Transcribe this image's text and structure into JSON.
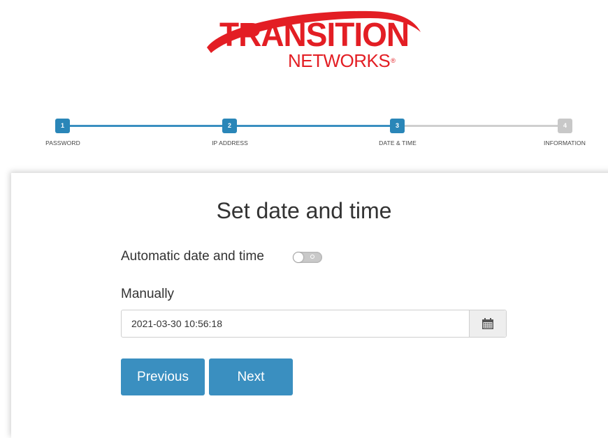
{
  "logo": {
    "line1": "TRANSITION",
    "line2": "NETWORKS",
    "reg": "®",
    "brand_color": "#e31e24"
  },
  "stepper": {
    "active_color": "#2a86b8",
    "inactive_color": "#c8c8c8",
    "current_step": 3,
    "steps": [
      {
        "number": "1",
        "label": "PASSWORD",
        "state": "done"
      },
      {
        "number": "2",
        "label": "IP ADDRESS",
        "state": "done"
      },
      {
        "number": "3",
        "label": "DATE & TIME",
        "state": "current"
      },
      {
        "number": "4",
        "label": "INFORMATION",
        "state": "pending"
      }
    ]
  },
  "card": {
    "title": "Set date and time",
    "auto_label": "Automatic date and time",
    "auto_enabled": false,
    "manual_label": "Manually",
    "datetime_value": "2021-03-30 10:56:18",
    "calendar_icon": "calendar-icon"
  },
  "buttons": {
    "previous": "Previous",
    "next": "Next",
    "color": "#3a8fc0"
  }
}
